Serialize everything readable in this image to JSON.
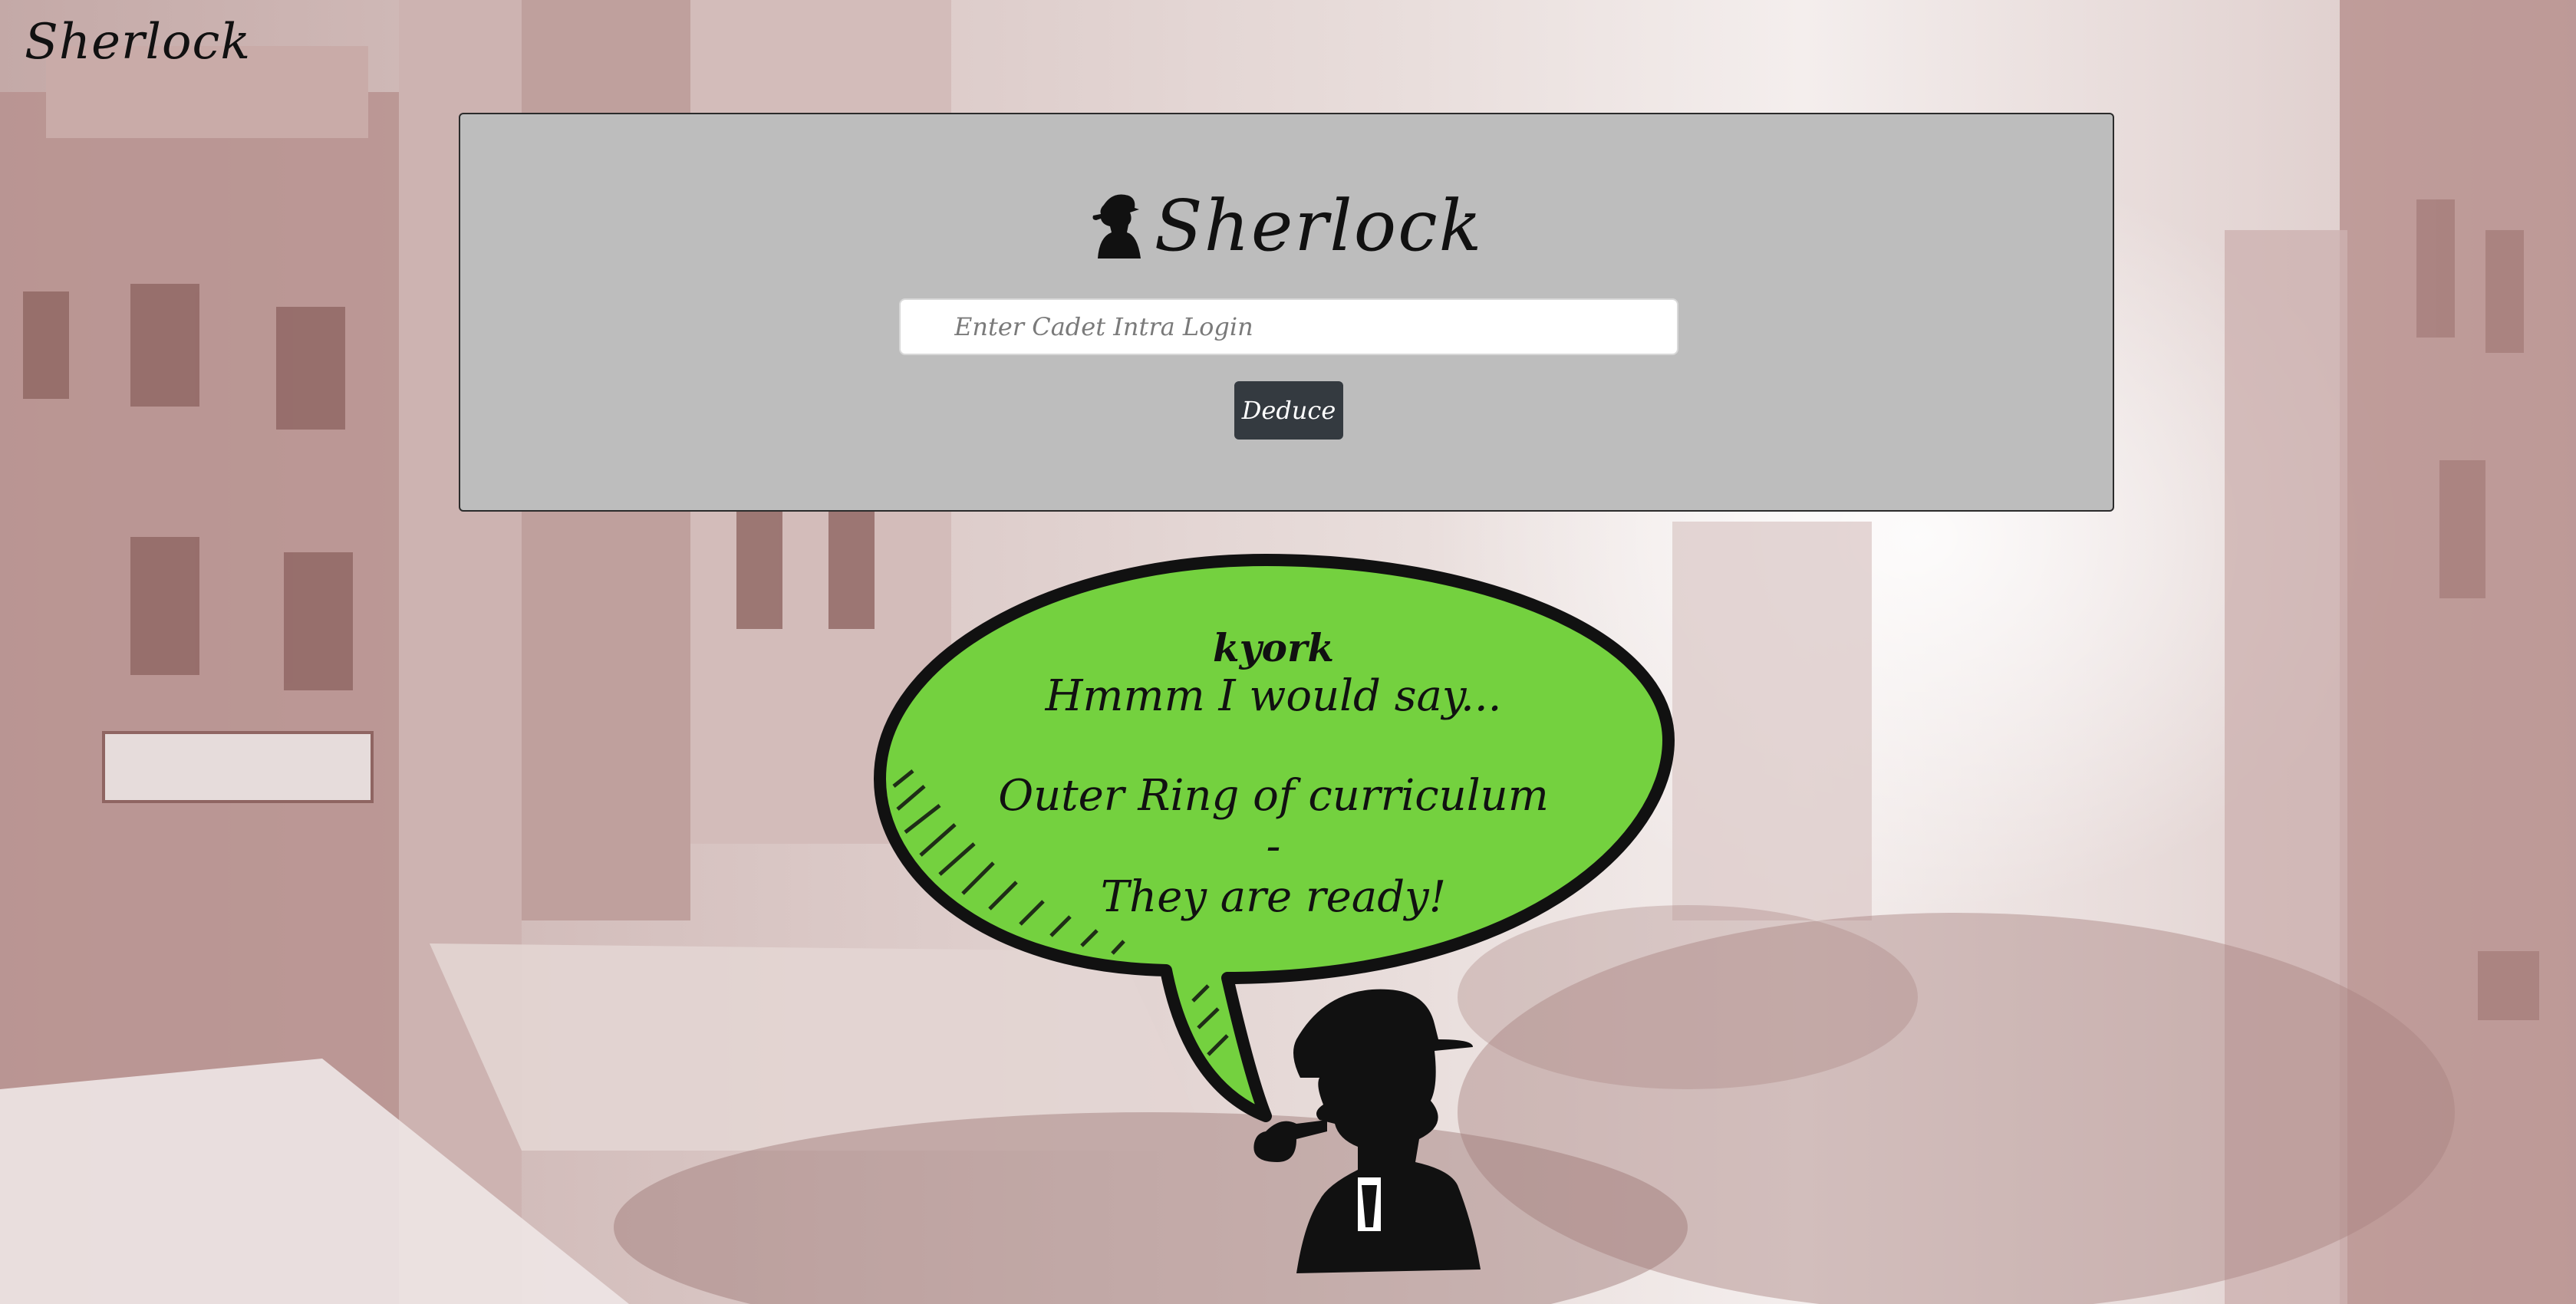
{
  "brand": {
    "title": "Sherlock"
  },
  "card": {
    "logo_text": "Sherlock",
    "login_placeholder": "Enter Cadet Intra Login",
    "login_value": "",
    "deduce_label": "Deduce"
  },
  "result": {
    "username": "kyork",
    "intro": "Hmmm I would say...",
    "verdict_line1": "Outer Ring of curriculum -",
    "verdict_line2": "They are ready!"
  },
  "colors": {
    "card_bg": "#bdbdbd",
    "button_bg": "#343a40",
    "bubble_fill": "#74d13f",
    "text": "#111111"
  },
  "icons": {
    "logo": "detective-silhouette-icon",
    "mascot": "sherlock-pipe-silhouette"
  }
}
